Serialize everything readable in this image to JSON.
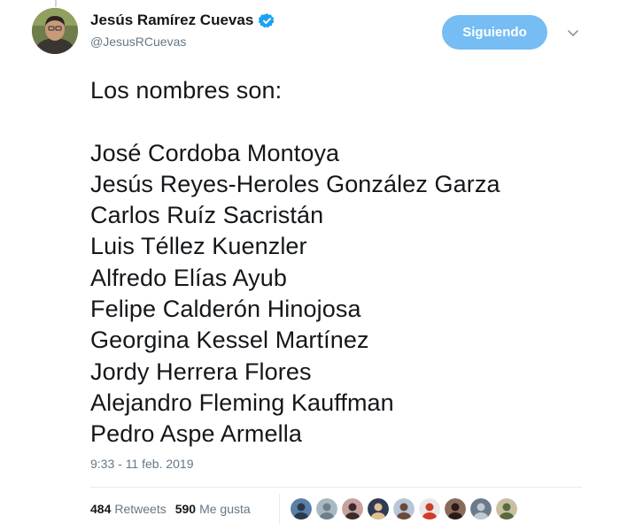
{
  "tweet": {
    "author": {
      "display_name": "Jesús Ramírez Cuevas",
      "handle": "@JesusRCuevas",
      "verified": true,
      "verified_icon": "verified-badge-icon"
    },
    "follow_button_label": "Siguiendo",
    "menu_icon": "chevron-down-icon",
    "body_lines": [
      "Los nombres son:",
      "",
      "José Cordoba Montoya",
      "Jesús Reyes-Heroles González Garza",
      "Carlos Ruíz Sacristán",
      "Luis Téllez Kuenzler",
      "Alfredo Elías Ayub",
      "Felipe Calderón Hinojosa",
      "Georgina Kessel Martínez",
      "Jordy Herrera Flores",
      "Alejandro Fleming Kauffman",
      "Pedro Aspe Armella"
    ],
    "timestamp": "9:33 - 11 feb. 2019",
    "stats": {
      "retweets_count": "484",
      "retweets_label": "Retweets",
      "likes_count": "590",
      "likes_label": "Me gusta"
    },
    "liker_avatars": [
      {
        "bg": "#5a7fa8",
        "fg": "#2b3a4a"
      },
      {
        "bg": "#aab8c2",
        "fg": "#6f7f8c"
      },
      {
        "bg": "#c9a0a0",
        "fg": "#3b2a2a"
      },
      {
        "bg": "#2f3a55",
        "fg": "#e0c090"
      },
      {
        "bg": "#b8c6d8",
        "fg": "#6b4a3a"
      },
      {
        "bg": "#e8e8e8",
        "fg": "#d23a2a"
      },
      {
        "bg": "#8a6a5a",
        "fg": "#2a1a1a"
      },
      {
        "bg": "#6b7a8a",
        "fg": "#c0c8d0"
      },
      {
        "bg": "#c8c0a0",
        "fg": "#5a6a40"
      }
    ]
  },
  "colors": {
    "follow_button": "#75bdf3",
    "verified_badge": "#1da1f2",
    "text_primary": "#14171a",
    "text_secondary": "#657786"
  }
}
